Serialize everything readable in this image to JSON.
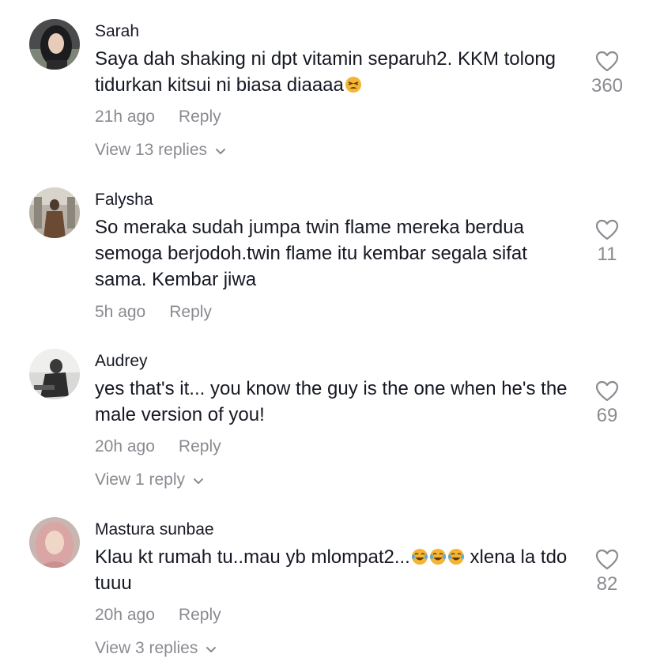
{
  "comments": [
    {
      "username": "Sarah",
      "text": "Saya dah shaking ni dpt vitamin separuh2. KKM tolong tidurkan kitsui ni biasa diaaaa",
      "emoji": "tired-face",
      "time": "21h ago",
      "reply": "Reply",
      "likes": "360",
      "view_replies": "View 13 replies"
    },
    {
      "username": "Falysha",
      "text": "So meraka sudah jumpa twin flame mereka berdua semoga berjodoh.twin flame itu kembar segala sifat sama. Kembar jiwa",
      "time": "5h ago",
      "reply": "Reply",
      "likes": "11"
    },
    {
      "username": "Audrey",
      "text": "yes that's it... you know the guy is the one when he's the male version of you!",
      "time": "20h ago",
      "reply": "Reply",
      "likes": "69",
      "view_replies": "View 1 reply"
    },
    {
      "username": "Mastura sunbae",
      "text": "Klau kt rumah tu..mau yb mlompat2...",
      "text_after_emoji": " xlena la tdo tuuu",
      "emoji": "tears-of-joy",
      "time": "20h ago",
      "reply": "Reply",
      "likes": "82",
      "view_replies": "View 3 replies"
    }
  ],
  "colors": {
    "text": "#161823",
    "muted": "#8a8b91",
    "emoji": "#F5B533"
  }
}
